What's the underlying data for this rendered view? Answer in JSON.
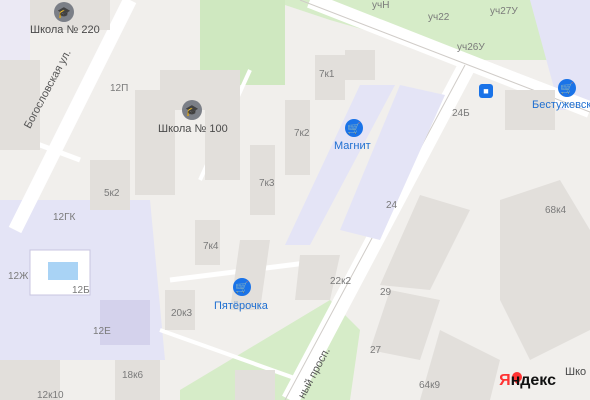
{
  "map": {
    "pois": {
      "school_220": "Школа № 220",
      "school_100": "Школа № 100",
      "magnit": "Магнит",
      "pyaterochka": "Пятёрочка",
      "bestuzhevsk": "Бестужевск"
    },
    "streets": {
      "bogoslovskaya": "Богословская ул.",
      "prospekt": "ный просп."
    },
    "houses": {
      "h12p": "12П",
      "h5k2": "5к2",
      "h7k1": "7к1",
      "h7k2": "7к2",
      "h7k3": "7к3",
      "h7k4": "7к4",
      "h12gk": "12ГК",
      "h12zh": "12Ж",
      "h12b": "12Б",
      "h12e": "12Е",
      "h20k3": "20к3",
      "h18k6": "18к6",
      "h12k10": "12к10",
      "h22k2": "22к2",
      "h24": "24",
      "h24b": "24Б",
      "h29": "29",
      "h27": "27",
      "h64k9": "64к9",
      "h68k4": "68к4",
      "uchN": "учН",
      "uch22": "уч22",
      "uch27U": "уч27У",
      "uch26U": "уч26У",
      "shko": "Шко"
    },
    "brand": {
      "ya": "Я",
      "ndex": "ндекс"
    },
    "icons": {
      "school": "school-icon",
      "shop": "shopping-basket-icon",
      "bus": "bus-stop-icon"
    },
    "colors": {
      "background": "#f1efec",
      "green": "#d6ecc8",
      "school_zone": "#e4e4f6",
      "building": "#e2dfdb",
      "accent": "#1a73e8"
    }
  }
}
